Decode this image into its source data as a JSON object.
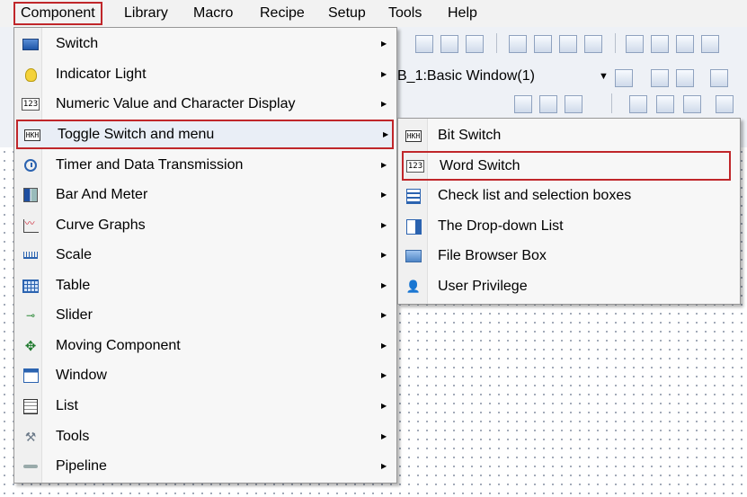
{
  "menubar": {
    "items": [
      "Component",
      "Library",
      "Macro",
      "Recipe",
      "Setup",
      "Tools",
      "Help"
    ],
    "active": "Component"
  },
  "toolbar": {
    "window_combo": "B_1:Basic Window(1)"
  },
  "component_menu": {
    "items": [
      {
        "label": "Switch",
        "icon": "switch-icon",
        "has_submenu": true
      },
      {
        "label": "Indicator Light",
        "icon": "bulb-icon",
        "has_submenu": true
      },
      {
        "label": "Numeric Value and Character Display",
        "icon": "numeric-123-icon",
        "has_submenu": true
      },
      {
        "label": "Toggle Switch and menu",
        "icon": "toggle-switch-icon",
        "has_submenu": true,
        "highlighted": true
      },
      {
        "label": "Timer and Data Transmission",
        "icon": "clock-icon",
        "has_submenu": true
      },
      {
        "label": "Bar And Meter",
        "icon": "bar-meter-icon",
        "has_submenu": true
      },
      {
        "label": "Curve Graphs",
        "icon": "curve-graph-icon",
        "has_submenu": true
      },
      {
        "label": "Scale",
        "icon": "scale-icon",
        "has_submenu": true
      },
      {
        "label": "Table",
        "icon": "table-icon",
        "has_submenu": true
      },
      {
        "label": "Slider",
        "icon": "slider-icon",
        "has_submenu": true
      },
      {
        "label": "Moving Component",
        "icon": "move-icon",
        "has_submenu": true
      },
      {
        "label": "Window",
        "icon": "window-icon",
        "has_submenu": true
      },
      {
        "label": "List",
        "icon": "list-icon",
        "has_submenu": true
      },
      {
        "label": "Tools",
        "icon": "tools-icon",
        "has_submenu": true
      },
      {
        "label": "Pipeline",
        "icon": "pipeline-icon",
        "has_submenu": true
      }
    ]
  },
  "toggle_submenu": {
    "items": [
      {
        "label": "Bit Switch",
        "icon": "bit-switch-icon"
      },
      {
        "label": "Word Switch",
        "icon": "word-switch-icon",
        "highlighted": true
      },
      {
        "label": "Check list and selection boxes",
        "icon": "check-list-icon"
      },
      {
        "label": "The Drop-down List",
        "icon": "dropdown-list-icon"
      },
      {
        "label": "File Browser Box",
        "icon": "file-browser-icon"
      },
      {
        "label": "User Privilege",
        "icon": "user-privilege-icon"
      }
    ]
  },
  "colors": {
    "highlight_border": "#c0262a",
    "menu_bg": "#f7f7f7"
  },
  "icons": {
    "submenu_arrow": "▶",
    "move_glyph": "✥",
    "tools_glyph": "⚒",
    "slider_glyph": "⊸",
    "user_glyph": "👤",
    "toggle_glyph": "HKH",
    "numeric_glyph": "123"
  }
}
